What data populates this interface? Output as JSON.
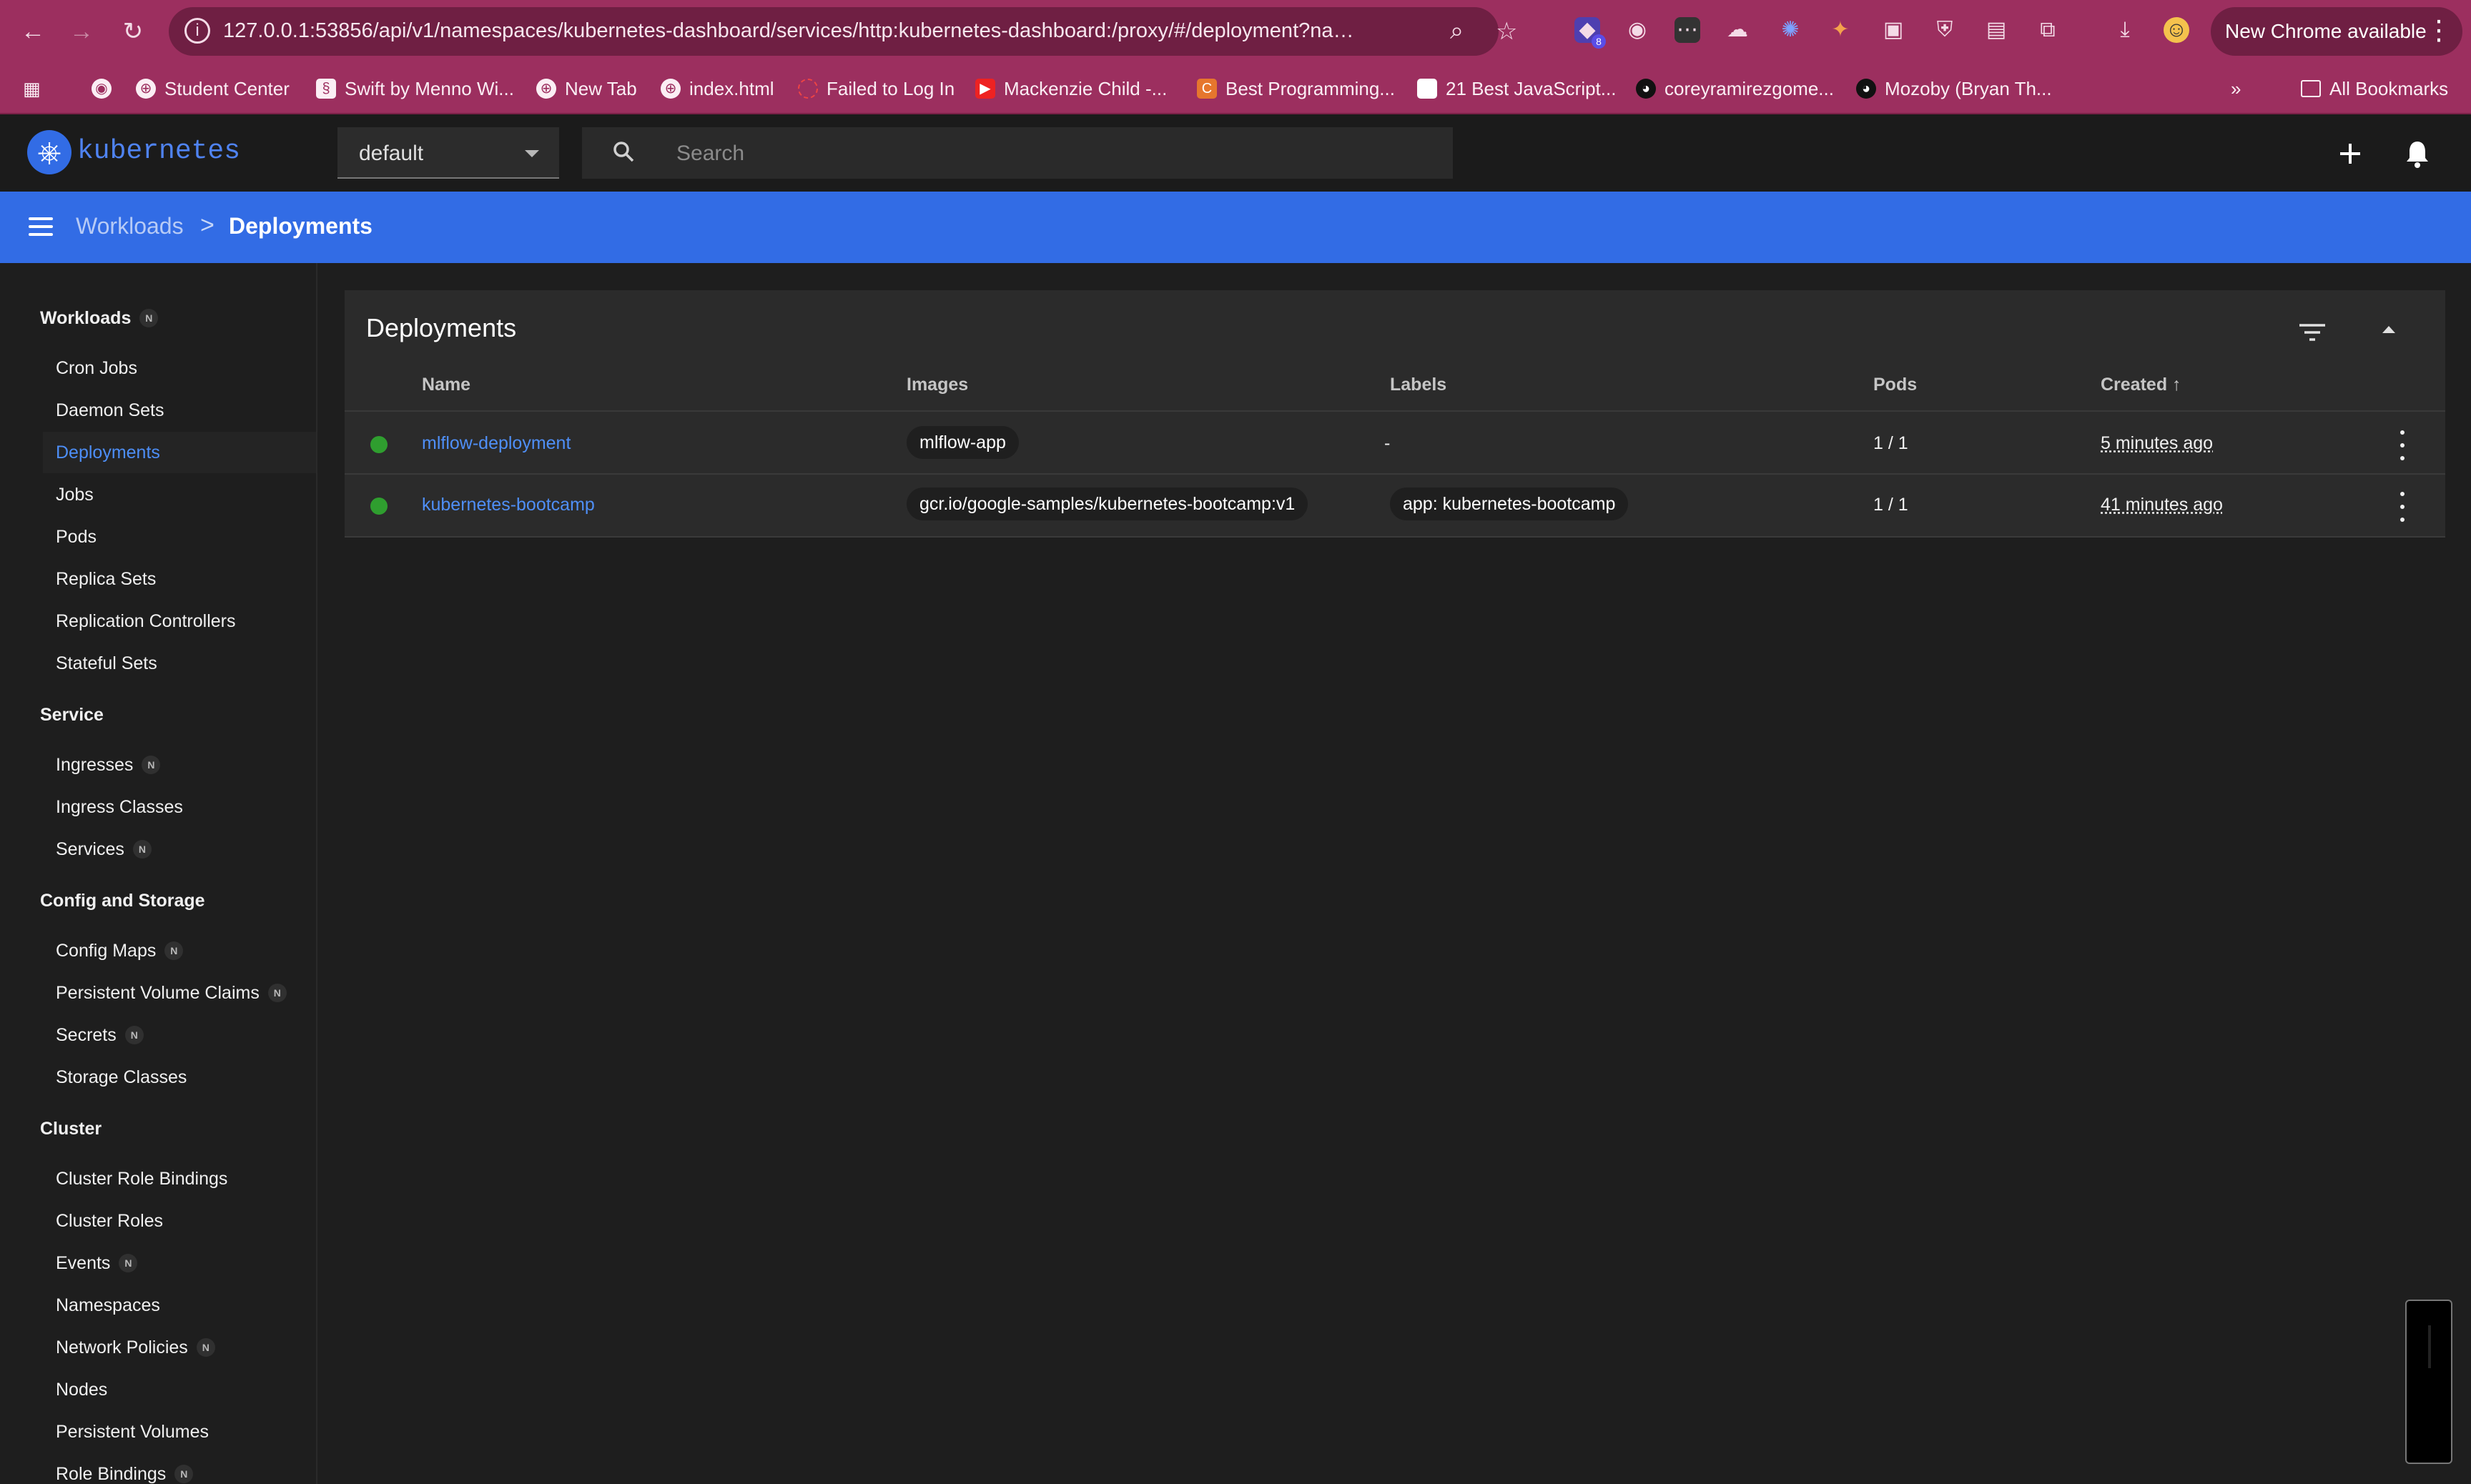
{
  "browser": {
    "url": "127.0.0.1:53856/api/v1/namespaces/kubernetes-dashboard/services/http:kubernetes-dashboard:/proxy/#/deployment?namesp...",
    "update_label": "New Chrome available",
    "extension_badge": "8",
    "bookmarks": [
      "Student Center",
      "Swift by Menno Wi...",
      "New Tab",
      "index.html",
      "Failed to Log In",
      "Mackenzie Child -...",
      "Best Programming...",
      "21 Best JavaScript...",
      "coreyramirezgome...",
      "Mozoby (Bryan Th..."
    ],
    "all_bookmarks": "All Bookmarks"
  },
  "header": {
    "title": "kubernetes",
    "namespace": "default",
    "search_placeholder": "Search"
  },
  "breadcrumb": {
    "parent": "Workloads",
    "separator": ">",
    "current": "Deployments"
  },
  "sidebar": {
    "sections": [
      {
        "title": "Workloads",
        "badge": "N"
      },
      {
        "title": "Service"
      },
      {
        "title": "Config and Storage"
      },
      {
        "title": "Cluster"
      }
    ],
    "workloads": [
      {
        "label": "Cron Jobs"
      },
      {
        "label": "Daemon Sets"
      },
      {
        "label": "Deployments"
      },
      {
        "label": "Jobs"
      },
      {
        "label": "Pods"
      },
      {
        "label": "Replica Sets"
      },
      {
        "label": "Replication Controllers"
      },
      {
        "label": "Stateful Sets"
      }
    ],
    "service": [
      {
        "label": "Ingresses",
        "badge": "N"
      },
      {
        "label": "Ingress Classes"
      },
      {
        "label": "Services",
        "badge": "N"
      }
    ],
    "config": [
      {
        "label": "Config Maps",
        "badge": "N"
      },
      {
        "label": "Persistent Volume Claims",
        "badge": "N"
      },
      {
        "label": "Secrets",
        "badge": "N"
      },
      {
        "label": "Storage Classes"
      }
    ],
    "cluster": [
      {
        "label": "Cluster Role Bindings"
      },
      {
        "label": "Cluster Roles"
      },
      {
        "label": "Events",
        "badge": "N"
      },
      {
        "label": "Namespaces"
      },
      {
        "label": "Network Policies",
        "badge": "N"
      },
      {
        "label": "Nodes"
      },
      {
        "label": "Persistent Volumes"
      },
      {
        "label": "Role Bindings",
        "badge": "N"
      }
    ]
  },
  "deployments": {
    "title": "Deployments",
    "columns": [
      "Name",
      "Images",
      "Labels",
      "Pods",
      "Created"
    ],
    "sort_arrow": "↑",
    "rows": [
      {
        "name": "mlflow-deployment",
        "image": "mlflow-app",
        "label": "-",
        "pods": "1 / 1",
        "created": "5 minutes ago"
      },
      {
        "name": "kubernetes-bootcamp",
        "image": "gcr.io/google-samples/kubernetes-bootcamp:v1",
        "label": "app: kubernetes-bootcamp",
        "pods": "1 / 1",
        "created": "41 minutes ago"
      }
    ]
  }
}
